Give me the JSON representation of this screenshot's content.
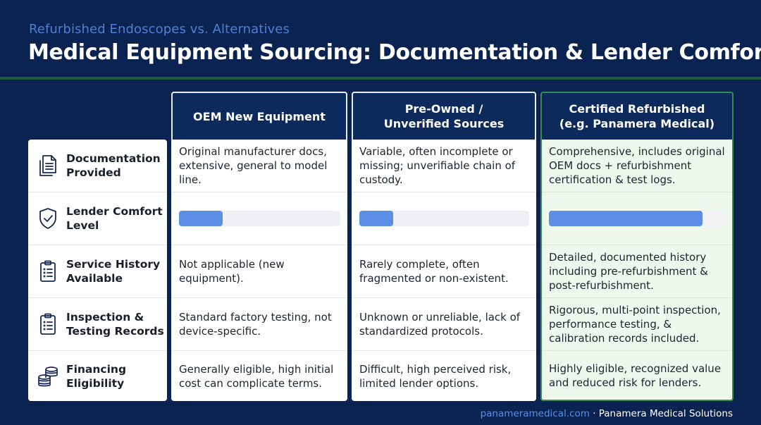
{
  "header": {
    "subtitle": "Refurbished Endoscopes vs. Alternatives",
    "title": "Medical Equipment Sourcing: Documentation & Lender Comfort"
  },
  "columns": [
    {
      "title": "OEM New Equipment",
      "highlighted": false
    },
    {
      "title": "Pre-Owned /\nUnverified Sources",
      "highlighted": false
    },
    {
      "title": "Certified Refurbished\n(e.g. Panamera Medical)",
      "highlighted": true
    }
  ],
  "rows": [
    {
      "label": "Documentation\nProvided",
      "icon": "document-icon",
      "cells": [
        "Original manufacturer docs, extensive, general to model line.",
        "Variable, often incomplete or missing; unverifiable chain of custody.",
        "Comprehensive, includes original OEM docs + refurbishment certification & test logs."
      ]
    },
    {
      "label": "Lender Comfort\nLevel",
      "icon": "shield-check-icon",
      "levels": [
        0.27,
        0.2,
        0.87
      ]
    },
    {
      "label": "Service History\nAvailable",
      "icon": "clipboard-list-icon",
      "cells": [
        "Not applicable (new equipment).",
        "Rarely complete, often fragmented or non-existent.",
        "Detailed, documented history including pre-refurbishment & post-refurbishment."
      ]
    },
    {
      "label": "Inspection &\nTesting Records",
      "icon": "clipboard-list-icon",
      "cells": [
        "Standard factory testing, not device-specific.",
        "Unknown or unreliable, lack of standardized protocols.",
        "Rigorous, multi-point inspection, performance testing, & calibration records included."
      ]
    },
    {
      "label": "Financing\nEligibility",
      "icon": "coins-stack-icon",
      "cells": [
        "Generally eligible, high initial cost can complicate terms.",
        "Difficult, high perceived risk, limited lender options.",
        "Highly eligible, recognized value and reduced risk for lenders."
      ]
    }
  ],
  "footer": {
    "link": "panameramedical.com",
    "separator": " · ",
    "company": "Panamera Medical Solutions"
  },
  "colors": {
    "background": "#0b2350",
    "accent_blue": "#5b8fe6",
    "highlight_green": "#3a8a55"
  }
}
